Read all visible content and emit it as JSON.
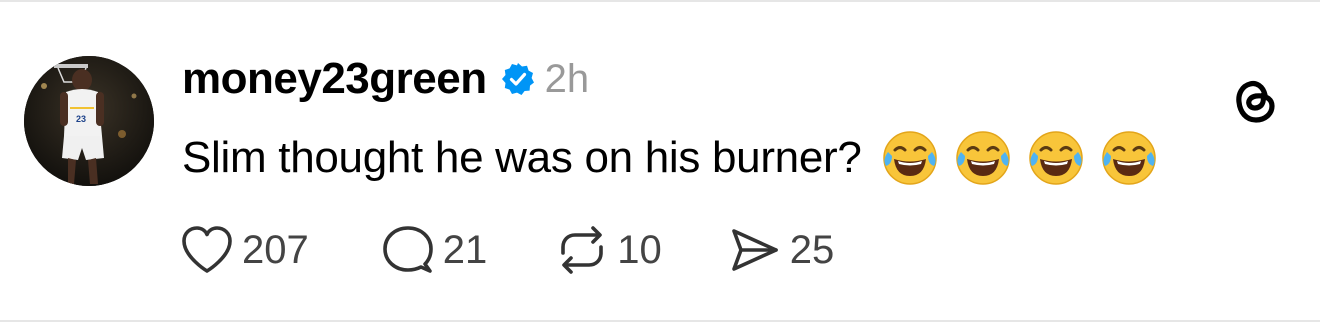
{
  "post": {
    "username": "money23green",
    "timestamp": "2h",
    "verified": true,
    "text": "Slim thought he was on his burner?",
    "emojis": [
      "face-with-tears-of-joy",
      "face-with-tears-of-joy",
      "face-with-tears-of-joy",
      "face-with-tears-of-joy"
    ]
  },
  "actions": {
    "like_count": "207",
    "reply_count": "21",
    "repost_count": "10",
    "share_count": "25"
  },
  "icons": {
    "like": "heart-icon",
    "reply": "speech-bubble-icon",
    "repost": "repost-arrows-icon",
    "share": "send-icon",
    "brand": "threads-logo-icon",
    "verified": "verified-badge-icon"
  },
  "colors": {
    "verified_blue": "#0095f6",
    "text": "#000000",
    "muted": "#999999",
    "count": "#444444"
  }
}
